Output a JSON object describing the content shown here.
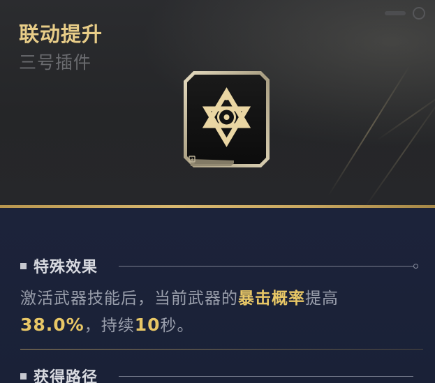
{
  "item": {
    "title": "联动提升",
    "subtitle": "三号插件",
    "slot_number": "3",
    "icon": "star-of-david-emblem-icon"
  },
  "special_effect": {
    "heading": "特殊效果",
    "description_prefix": "激活武器技能后，当前武器的",
    "highlight_stat": "暴击概率",
    "description_mid": "提高",
    "highlight_value": "38.0%",
    "description_mid2": "，持续",
    "highlight_duration": "10",
    "description_suffix": "秒。"
  },
  "acquisition": {
    "heading": "获得路径"
  },
  "colors": {
    "accent_gold": "#e8cd88",
    "highlight_yellow": "#e8c766",
    "body_bg": "#1b2238",
    "header_bg": "#2b2c2f"
  }
}
